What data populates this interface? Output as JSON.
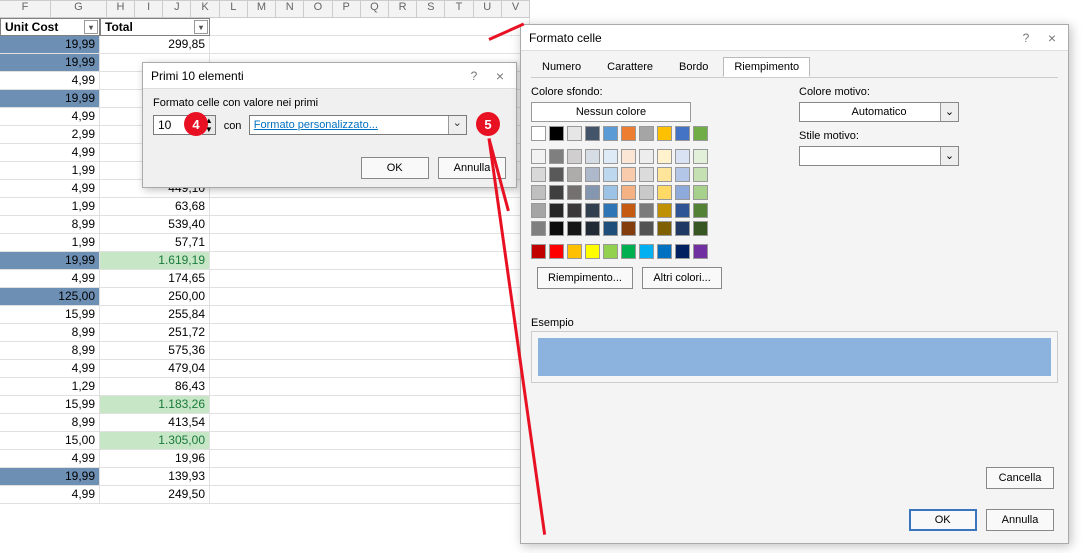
{
  "sheet": {
    "cols": [
      "F",
      "G",
      "H",
      "I",
      "J",
      "K",
      "L",
      "M",
      "N",
      "O",
      "P",
      "Q",
      "R",
      "S",
      "T",
      "U",
      "V"
    ],
    "head_unit": "Unit Cost",
    "head_total": "Total",
    "rows": [
      {
        "u": "19,99",
        "t": "299,85",
        "uc": "sel-blue",
        "tc": ""
      },
      {
        "u": "19,99",
        "t": "",
        "uc": "sel-blue",
        "tc": ""
      },
      {
        "u": "4,99",
        "t": "",
        "uc": "",
        "tc": ""
      },
      {
        "u": "19,99",
        "t": "",
        "uc": "sel-blue",
        "tc": ""
      },
      {
        "u": "4,99",
        "t": "",
        "uc": "",
        "tc": ""
      },
      {
        "u": "2,99",
        "t": "",
        "uc": "",
        "tc": ""
      },
      {
        "u": "4,99",
        "t": "",
        "uc": "",
        "tc": ""
      },
      {
        "u": "1,99",
        "t": "",
        "uc": "",
        "tc": ""
      },
      {
        "u": "4,99",
        "t": "449,10",
        "uc": "",
        "tc": ""
      },
      {
        "u": "1,99",
        "t": "63,68",
        "uc": "",
        "tc": ""
      },
      {
        "u": "8,99",
        "t": "539,40",
        "uc": "",
        "tc": ""
      },
      {
        "u": "1,99",
        "t": "57,71",
        "uc": "",
        "tc": ""
      },
      {
        "u": "19,99",
        "t": "1.619,19",
        "uc": "sel-blue",
        "tc": "sel-green"
      },
      {
        "u": "4,99",
        "t": "174,65",
        "uc": "",
        "tc": ""
      },
      {
        "u": "125,00",
        "t": "250,00",
        "uc": "sel-blue",
        "tc": ""
      },
      {
        "u": "15,99",
        "t": "255,84",
        "uc": "",
        "tc": ""
      },
      {
        "u": "8,99",
        "t": "251,72",
        "uc": "",
        "tc": ""
      },
      {
        "u": "8,99",
        "t": "575,36",
        "uc": "",
        "tc": ""
      },
      {
        "u": "4,99",
        "t": "479,04",
        "uc": "",
        "tc": ""
      },
      {
        "u": "1,29",
        "t": "86,43",
        "uc": "",
        "tc": ""
      },
      {
        "u": "15,99",
        "t": "1.183,26",
        "uc": "",
        "tc": "sel-green"
      },
      {
        "u": "8,99",
        "t": "413,54",
        "uc": "",
        "tc": ""
      },
      {
        "u": "15,00",
        "t": "1.305,00",
        "uc": "",
        "tc": "sel-green"
      },
      {
        "u": "4,99",
        "t": "19,96",
        "uc": "",
        "tc": ""
      },
      {
        "u": "19,99",
        "t": "139,93",
        "uc": "sel-blue",
        "tc": ""
      },
      {
        "u": "4,99",
        "t": "249,50",
        "uc": "",
        "tc": ""
      }
    ]
  },
  "dlg1": {
    "title": "Primi 10 elementi",
    "label": "Formato celle con valore nei primi",
    "value": "10",
    "con": "con",
    "select": "Formato personalizzato...",
    "ok": "OK",
    "cancel": "Annulla"
  },
  "dlg2": {
    "title": "Formato celle",
    "tabs": [
      "Numero",
      "Carattere",
      "Bordo",
      "Riempimento"
    ],
    "active_tab": 3,
    "bg_label": "Colore sfondo:",
    "nocolor": "Nessun colore",
    "fill_effects": "Riempimento...",
    "more_colors": "Altri colori...",
    "pattern_color_label": "Colore motivo:",
    "pattern_color_value": "Automatico",
    "pattern_style_label": "Stile motivo:",
    "example_label": "Esempio",
    "clear": "Cancella",
    "ok": "OK",
    "cancel": "Annulla"
  },
  "annotations": {
    "a4": "4",
    "a5": "5"
  },
  "colors": {
    "themerow1": [
      "#ffffff",
      "#000000",
      "#e7e6e6",
      "#44546a",
      "#5b9bd5",
      "#ed7d31",
      "#a5a5a5",
      "#ffc000",
      "#4472c4",
      "#70ad47"
    ],
    "grid": [
      [
        "#f2f2f2",
        "#7f7f7f",
        "#d0cece",
        "#d6dce4",
        "#deebf6",
        "#fbe5d5",
        "#ededed",
        "#fff2cc",
        "#d9e2f3",
        "#e2efd9"
      ],
      [
        "#d8d8d8",
        "#595959",
        "#aeabab",
        "#adb9ca",
        "#bdd7ee",
        "#f7cbac",
        "#dbdbdb",
        "#fee599",
        "#b4c6e7",
        "#c5e0b3"
      ],
      [
        "#bfbfbf",
        "#3f3f3f",
        "#757070",
        "#8496b0",
        "#9cc3e5",
        "#f4b183",
        "#c9c9c9",
        "#ffd965",
        "#8eaadb",
        "#a8d08d"
      ],
      [
        "#a5a5a5",
        "#262626",
        "#3a3838",
        "#323f4f",
        "#2e75b5",
        "#c55a11",
        "#7b7b7b",
        "#bf9000",
        "#2f5496",
        "#538135"
      ],
      [
        "#7f7f7f",
        "#0c0c0c",
        "#171616",
        "#222a35",
        "#1e4e79",
        "#833c0b",
        "#525252",
        "#7f6000",
        "#1f3864",
        "#375623"
      ]
    ],
    "standard": [
      "#c00000",
      "#ff0000",
      "#ffc000",
      "#ffff00",
      "#92d050",
      "#00b050",
      "#00b0f0",
      "#0070c0",
      "#002060",
      "#7030a0"
    ]
  }
}
